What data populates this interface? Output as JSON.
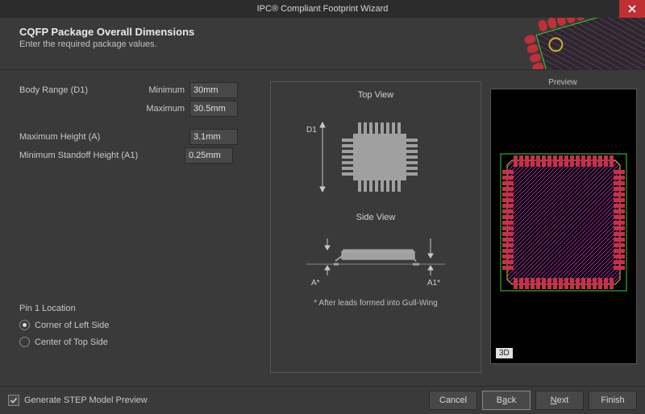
{
  "title": "IPC® Compliant Footprint Wizard",
  "header": {
    "heading": "CQFP Package Overall Dimensions",
    "subheading": "Enter the required package values."
  },
  "fields": {
    "body_range_label": "Body Range (D1)",
    "minimum_label": "Minimum",
    "maximum_label": "Maximum",
    "body_range_min": "30mm",
    "body_range_max": "30.5mm",
    "max_height_label": "Maximum Height (A)",
    "max_height": "3.1mm",
    "min_standoff_label": "Minimum Standoff Height (A1)",
    "min_standoff": "0.25mm"
  },
  "pin1": {
    "title": "Pin 1 Location",
    "opt_corner": "Corner of Left Side",
    "opt_center": "Center of Top Side",
    "selected": "corner"
  },
  "diagram": {
    "top_view": "Top View",
    "side_view": "Side View",
    "d1": "D1",
    "a_label": "A*",
    "a1_label": "A1*",
    "footnote": "* After leads formed into Gull-Wing"
  },
  "preview": {
    "title": "Preview",
    "badge": "3D"
  },
  "footer": {
    "generate_step": "Generate STEP Model Preview",
    "cancel": "Cancel",
    "back_pre": "B",
    "back_u": "a",
    "back_post": "ck",
    "next_u": "N",
    "next_post": "ext",
    "finish": "Finish"
  }
}
